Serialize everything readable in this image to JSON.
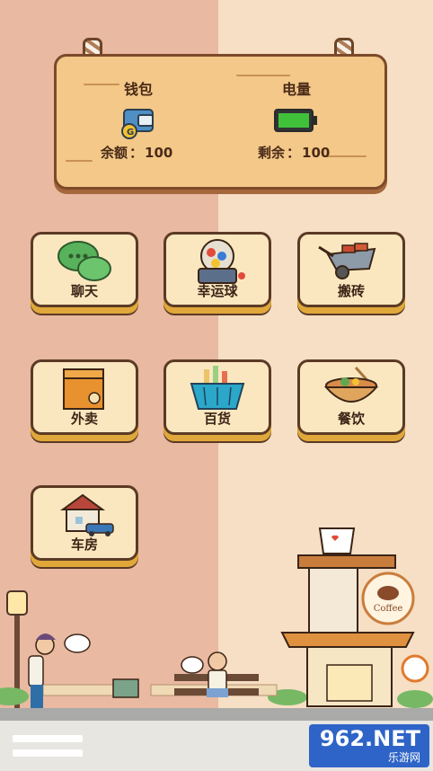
{
  "wallet": {
    "title": "钱包",
    "balance_label": "余额",
    "balance_value": "100"
  },
  "power": {
    "title": "电量",
    "remain_label": "剩余",
    "remain_value": "100",
    "level": 1.0
  },
  "menu": [
    {
      "label": "聊天",
      "icon": "chat-bubbles-icon"
    },
    {
      "label": "幸运球",
      "icon": "lucky-ball-machine-icon"
    },
    {
      "label": "搬砖",
      "icon": "brick-wheelbarrow-icon"
    },
    {
      "label": "外卖",
      "icon": "delivery-box-icon"
    },
    {
      "label": "百货",
      "icon": "shopping-basket-icon"
    },
    {
      "label": "餐饮",
      "icon": "food-bowl-icon"
    },
    {
      "label": "车房",
      "icon": "house-car-icon"
    }
  ],
  "cafe_sign": "Coffee",
  "watermark": {
    "main": "962.NET",
    "sub": "乐游网"
  }
}
